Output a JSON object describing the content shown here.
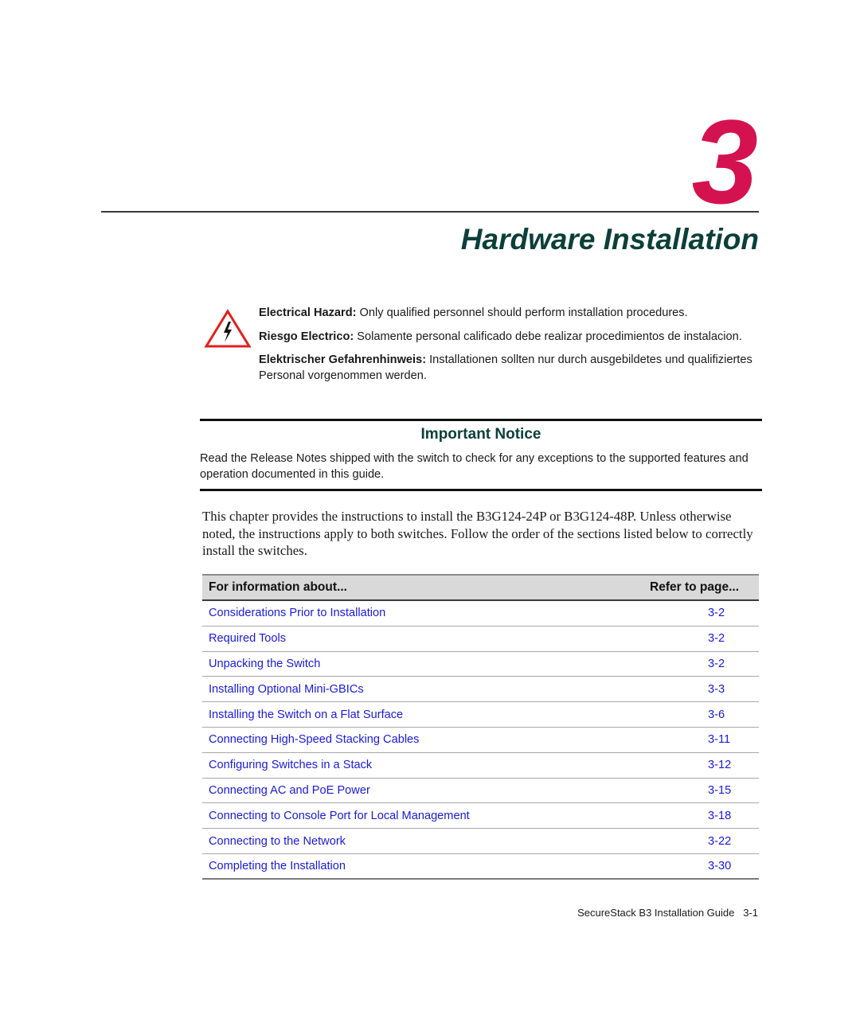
{
  "chapter": {
    "number": "3",
    "title": "Hardware Installation"
  },
  "hazard": {
    "icon": "electrical-hazard-warning-icon",
    "notices": [
      {
        "label": "Electrical Hazard:",
        "text": " Only qualified personnel should perform installation procedures."
      },
      {
        "label": "Riesgo Electrico:",
        "text": " Solamente personal calificado debe realizar procedimientos de instalacion."
      },
      {
        "label": "Elektrischer Gefahrenhinweis:",
        "text": " Installationen sollten nur durch ausgebildetes und qualifiziertes Personal vorgenommen werden."
      }
    ]
  },
  "important_notice": {
    "title": "Important Notice",
    "body": "Read the Release Notes shipped with the switch to check for any exceptions to the supported features and operation documented in this guide."
  },
  "intro": "This chapter provides the instructions to install the B3G124-24P or B3G124-48P. Unless otherwise noted, the instructions apply to both switches. Follow the order of the sections listed below to correctly install the switches.",
  "toc": {
    "headers": [
      "For information about...",
      "Refer to page..."
    ],
    "rows": [
      {
        "topic": "Considerations Prior to Installation",
        "page": "3-2"
      },
      {
        "topic": "Required Tools",
        "page": "3-2"
      },
      {
        "topic": "Unpacking the Switch",
        "page": "3-2"
      },
      {
        "topic": "Installing Optional Mini-GBICs",
        "page": "3-3"
      },
      {
        "topic": "Installing the Switch on a Flat Surface",
        "page": "3-6"
      },
      {
        "topic": "Connecting High-Speed Stacking Cables",
        "page": "3-11"
      },
      {
        "topic": "Configuring Switches in a Stack",
        "page": "3-12"
      },
      {
        "topic": "Connecting AC and PoE Power",
        "page": "3-15"
      },
      {
        "topic": "Connecting to Console Port for Local Management",
        "page": "3-18"
      },
      {
        "topic": "Connecting to the Network",
        "page": "3-22"
      },
      {
        "topic": "Completing the Installation",
        "page": "3-30"
      }
    ]
  },
  "footer": {
    "guide_title": "SecureStack B3 Installation Guide",
    "page_number": "3-1"
  },
  "colors": {
    "chapter_number": "#d4124f",
    "heading": "#0b3f3a",
    "link": "#1a1adb",
    "hazard_red": "#e0201c"
  }
}
